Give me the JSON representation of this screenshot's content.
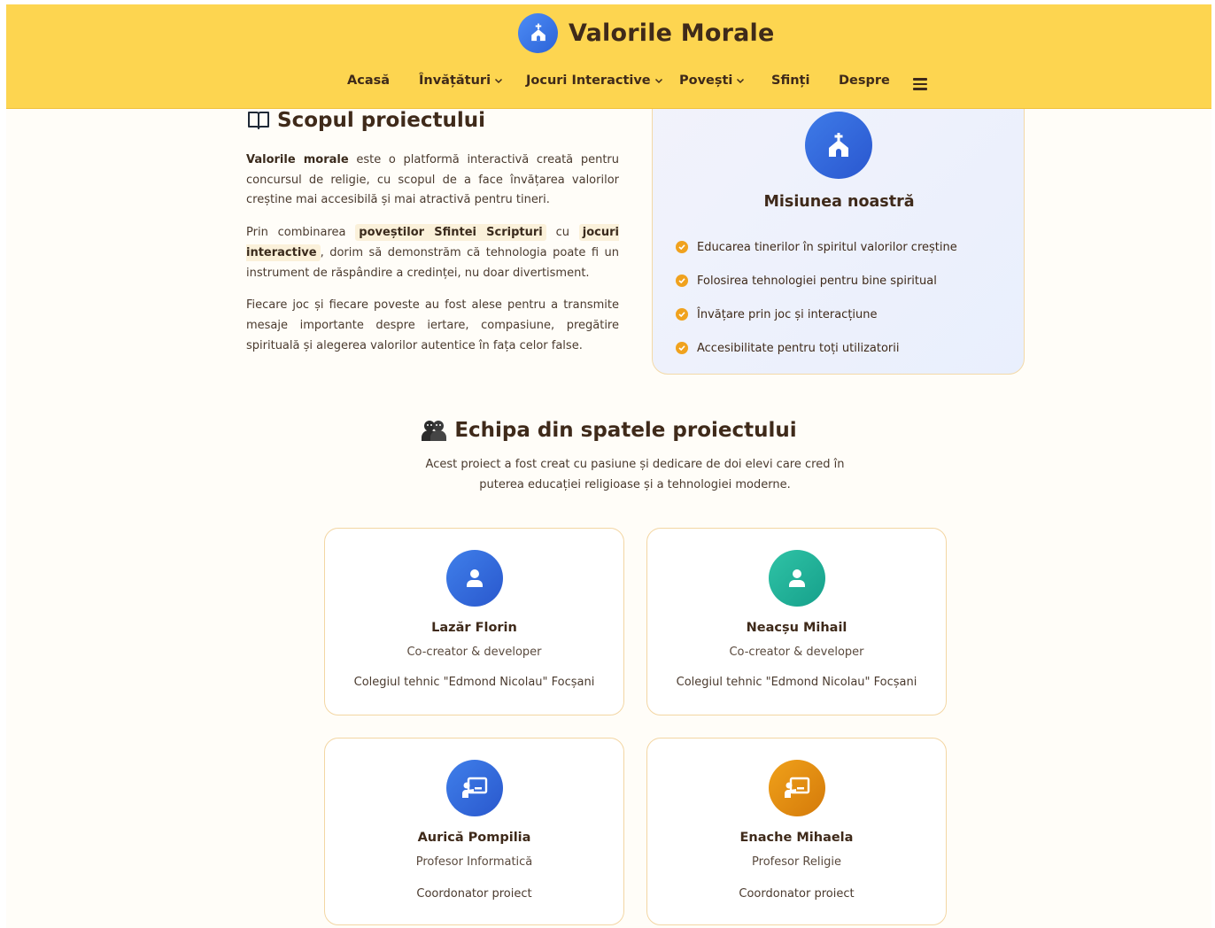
{
  "header": {
    "title": "Valorile Morale",
    "nav": [
      {
        "label": "Acasă",
        "dropdown": false
      },
      {
        "label": "Învățături",
        "dropdown": true
      },
      {
        "label": "Jocuri Interactive",
        "dropdown": true
      },
      {
        "label": "Povești",
        "dropdown": true
      },
      {
        "label": "Sfinți",
        "dropdown": false
      },
      {
        "label": "Despre",
        "dropdown": false
      }
    ]
  },
  "scope": {
    "title": "Scopul proiectului",
    "p1_bold": "Valorile morale",
    "p1_rest": " este o platformă interactivă creată pentru concursul de religie, cu scopul de a face învățarea valorilor creștine mai accesibilă și mai atractivă pentru tineri.",
    "p2_start": "Prin combinarea ",
    "p2_hl1": "poveștilor Sfintei Scripturi",
    "p2_mid": " cu ",
    "p2_hl2": "jocuri interactive",
    "p2_end": ", dorim să demonstrăm că tehnologia poate fi un instrument de răspândire a credinței, nu doar divertisment.",
    "p3": "Fiecare joc și fiecare poveste au fost alese pentru a transmite mesaje importante despre iertare, compasiune, pregătire spirituală și alegerea valorilor autentice în fața celor false."
  },
  "mission": {
    "title": "Misiunea noastră",
    "items": [
      "Educarea tinerilor în spiritul valorilor creștine",
      "Folosirea tehnologiei pentru bine spiritual",
      "Învățare prin joc și interacțiune",
      "Accesibilitate pentru toți utilizatorii"
    ]
  },
  "team": {
    "title": "Echipa din spatele proiectului",
    "description": "Acest proiect a fost creat cu pasiune și dedicare de doi elevi care cred în puterea educației religioase și a tehnologiei moderne.",
    "members": [
      {
        "name": "Lazăr Florin",
        "role": "Co-creator & developer",
        "detail": "Colegiul tehnic \"Edmond Nicolau\" Focșani",
        "icon": "user-icon",
        "color": "#2a58cd"
      },
      {
        "name": "Neacșu Mihail",
        "role": "Co-creator & developer",
        "detail": "Colegiul tehnic \"Edmond Nicolau\" Focșani",
        "icon": "user-icon",
        "color": "#16a08b"
      },
      {
        "name": "Aurică Pompilia",
        "role": "Profesor Informatică",
        "detail": "Coordonator proiect",
        "icon": "teacher-icon",
        "color": "#2a58cd"
      },
      {
        "name": "Enache Mihaela",
        "role": "Profesor Religie",
        "detail": "Coordonator proiect",
        "icon": "teacher-icon",
        "color": "#d47a0a"
      }
    ]
  }
}
